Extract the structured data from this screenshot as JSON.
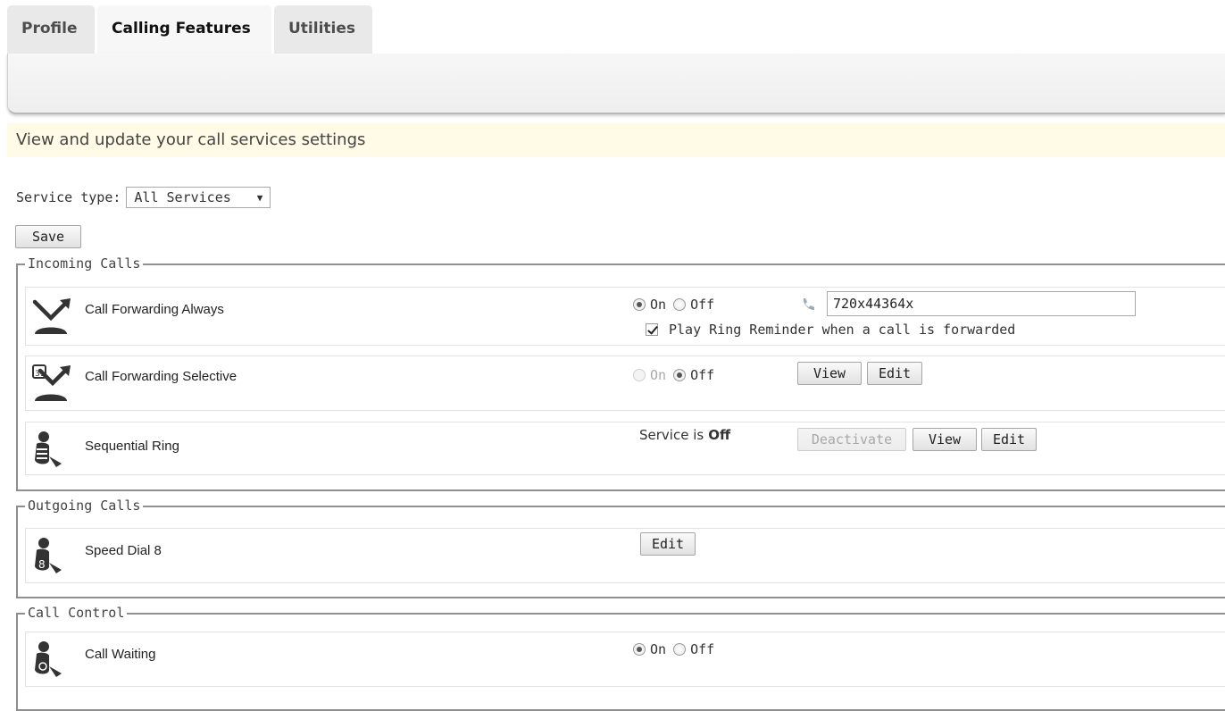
{
  "tabs": [
    {
      "label": "Profile"
    },
    {
      "label": "Calling Features"
    },
    {
      "label": "Utilities"
    }
  ],
  "banner": {
    "text": "View and update your call services settings"
  },
  "service_type": {
    "label": "Service type:",
    "selected": "All Services",
    "arrow": "▼"
  },
  "save_label": "Save",
  "groups": {
    "incoming": {
      "title": "Incoming Calls"
    },
    "outgoing": {
      "title": "Outgoing Calls"
    },
    "control": {
      "title": "Call Control"
    }
  },
  "services": {
    "cfa": {
      "name": "Call Forwarding Always",
      "on_label": "On",
      "off_label": "Off",
      "state": "on",
      "forward_number": "720x44364x",
      "reminder_label": "Play Ring Reminder when a call is forwarded",
      "reminder_checked": true
    },
    "cfs": {
      "name": "Call Forwarding Selective",
      "on_label": "On",
      "off_label": "Off",
      "state": "off",
      "view_label": "View",
      "edit_label": "Edit"
    },
    "seq": {
      "name": "Sequential Ring",
      "status_prefix": "Service is",
      "status_value": "Off",
      "deactivate_label": "Deactivate",
      "view_label": "View",
      "edit_label": "Edit"
    },
    "speed": {
      "name": "Speed Dial 8",
      "edit_label": "Edit"
    },
    "waiting": {
      "name": "Call Waiting",
      "on_label": "On",
      "off_label": "Off",
      "state": "on"
    }
  },
  "colors": {
    "banner": "#fffbe6",
    "border": "#8f8f8f",
    "icon": "#333333"
  }
}
